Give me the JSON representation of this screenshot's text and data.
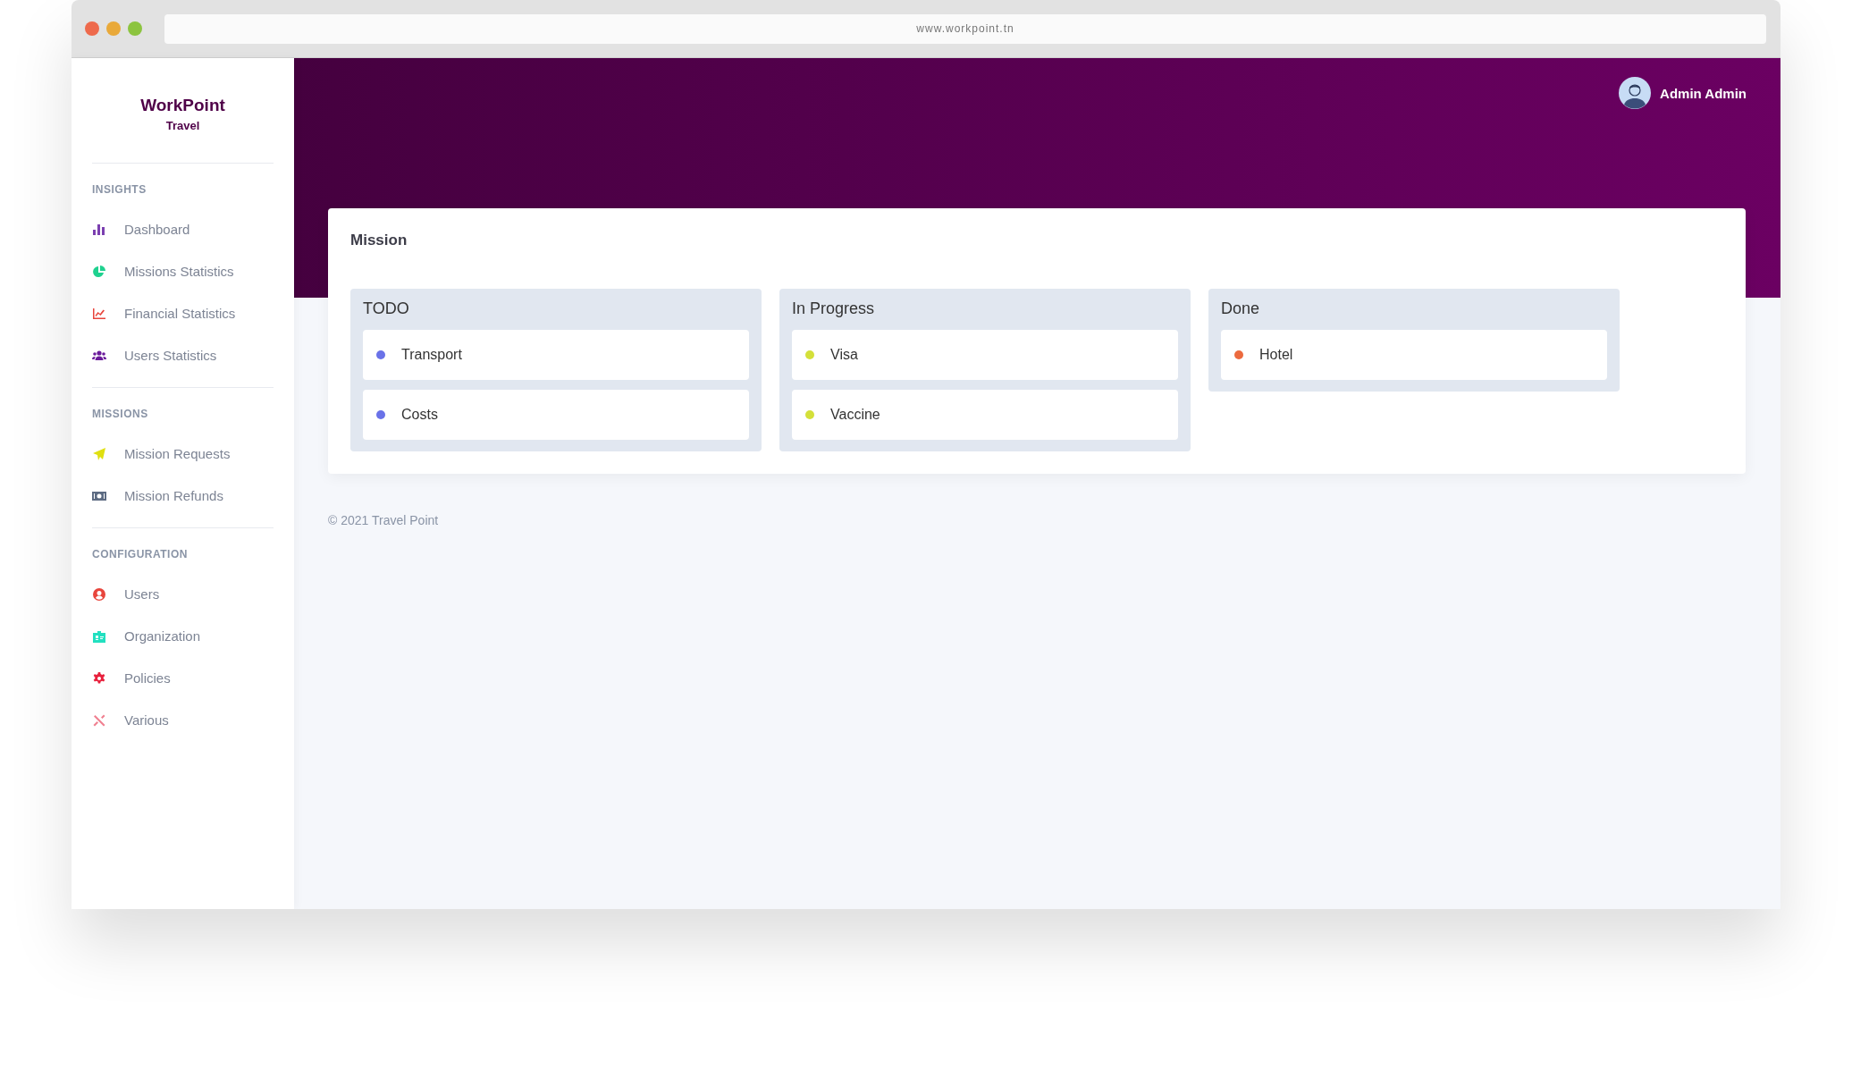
{
  "browser": {
    "url": "www.workpoint.tn"
  },
  "logo": {
    "name": "WorkPoint",
    "subtitle": "Travel"
  },
  "sidebar": {
    "sections": [
      {
        "title": "INSIGHTS",
        "items": [
          {
            "kind": "bars",
            "label": "Dashboard"
          },
          {
            "kind": "pie",
            "label": "Missions Statistics"
          },
          {
            "kind": "trend",
            "label": "Financial Statistics"
          },
          {
            "kind": "group",
            "label": "Users Statistics"
          }
        ]
      },
      {
        "title": "MISSIONS",
        "items": [
          {
            "kind": "plane",
            "label": "Mission Requests"
          },
          {
            "kind": "bill",
            "label": "Mission Refunds"
          }
        ]
      },
      {
        "title": "CONFIGURATION",
        "items": [
          {
            "kind": "person",
            "label": "Users"
          },
          {
            "kind": "badge",
            "label": "Organization"
          },
          {
            "kind": "cog",
            "label": "Policies"
          },
          {
            "kind": "tools",
            "label": "Various"
          }
        ]
      }
    ]
  },
  "user": {
    "name": "Admin Admin"
  },
  "board": {
    "title": "Mission",
    "columns": [
      {
        "title": "TODO",
        "cards": [
          {
            "label": "Transport",
            "color": "#6a72e8"
          },
          {
            "label": "Costs",
            "color": "#6a72e8"
          }
        ]
      },
      {
        "title": "In Progress",
        "cards": [
          {
            "label": "Visa",
            "color": "#d4e03a"
          },
          {
            "label": "Vaccine",
            "color": "#d4e03a"
          }
        ]
      },
      {
        "title": "Done",
        "cards": [
          {
            "label": "Hotel",
            "color": "#ec6a3e"
          }
        ]
      }
    ]
  },
  "footer": "© 2021 Travel Point"
}
